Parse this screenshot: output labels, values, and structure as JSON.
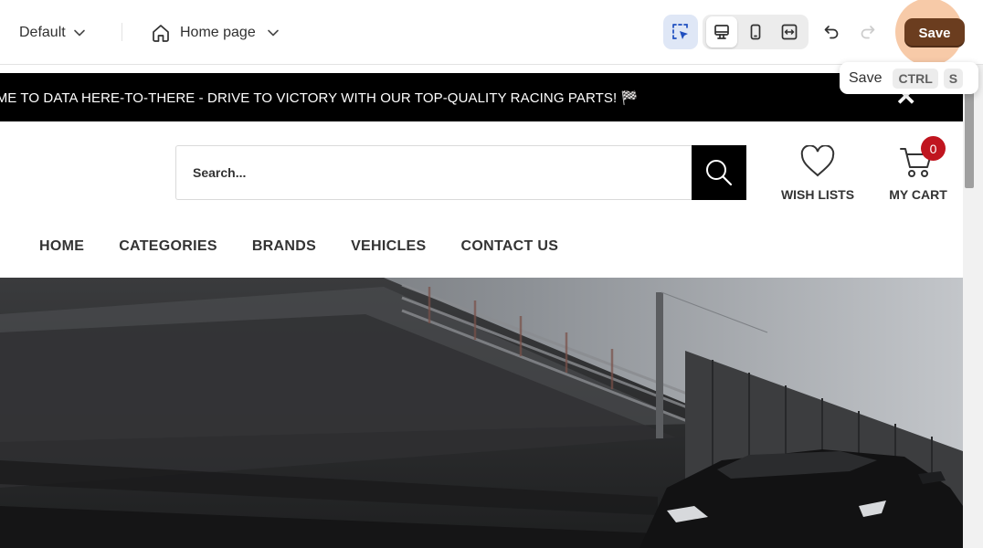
{
  "editor": {
    "theme_selector": "Default",
    "page_selector": "Home page",
    "save_label": "Save",
    "tooltip": {
      "label": "Save",
      "keys": [
        "CTRL",
        "S"
      ]
    }
  },
  "store": {
    "announcement": "COME TO DATA HERE-TO-THERE - DRIVE TO VICTORY WITH OUR TOP-QUALITY RACING PARTS! 🏁",
    "close_symbol": "✕",
    "search": {
      "placeholder": "Search..."
    },
    "wishlist_label": "WISH LISTS",
    "cart_label": "MY CART",
    "cart_count": "0",
    "nav": [
      "HOME",
      "CATEGORIES",
      "BRANDS",
      "VEHICLES",
      "CONTACT US"
    ]
  },
  "colors": {
    "save_button": "#6b3d1f",
    "save_highlight": "#f09e60",
    "select_tool_bg": "#dfe7f6",
    "cart_badge": "#c0151f",
    "announcement_bg": "#000000"
  },
  "icons": [
    "chevron-down-icon",
    "home-icon",
    "select-tool-icon",
    "desktop-icon",
    "mobile-icon",
    "full-width-icon",
    "undo-icon",
    "redo-icon",
    "search-icon",
    "heart-icon",
    "cart-icon",
    "close-icon"
  ]
}
